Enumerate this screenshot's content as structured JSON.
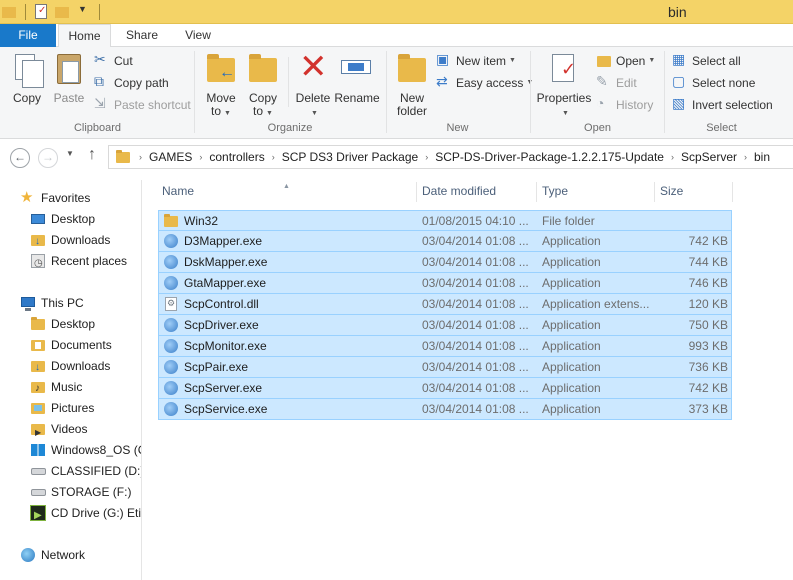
{
  "window": {
    "title": "bin"
  },
  "ribbon_tabs": [
    "File",
    "Home",
    "Share",
    "View"
  ],
  "clipboard": {
    "copy": "Copy",
    "paste": "Paste",
    "cut": "Cut",
    "copy_path": "Copy path",
    "paste_shortcut": "Paste shortcut",
    "label": "Clipboard"
  },
  "organize": {
    "move_to_1": "Move",
    "move_to_2": "to",
    "copy_to_1": "Copy",
    "copy_to_2": "to",
    "delete": "Delete",
    "rename": "Rename",
    "label": "Organize"
  },
  "new_group": {
    "new_folder_1": "New",
    "new_folder_2": "folder",
    "new_item": "New item",
    "easy_access": "Easy access",
    "label": "New"
  },
  "open_group": {
    "properties": "Properties",
    "open": "Open",
    "edit": "Edit",
    "history": "History",
    "label": "Open"
  },
  "select_group": {
    "select_all": "Select all",
    "select_none": "Select none",
    "invert": "Invert selection",
    "label": "Select"
  },
  "address": {
    "crumbs": [
      "GAMES",
      "controllers",
      "SCP DS3 Driver Package",
      "SCP-DS-Driver-Package-1.2.2.175-Update",
      "ScpServer",
      "bin"
    ]
  },
  "nav": {
    "favorites": "Favorites",
    "desktop": "Desktop",
    "downloads": "Downloads",
    "recent": "Recent places",
    "this_pc": "This PC",
    "pc_desktop": "Desktop",
    "documents": "Documents",
    "pc_downloads": "Downloads",
    "music": "Music",
    "pictures": "Pictures",
    "videos": "Videos",
    "win8": "Windows8_OS (C",
    "classified": "CLASSIFIED (D:)",
    "storage": "STORAGE (F:)",
    "cd": "CD Drive (G:) Etis",
    "network": "Network"
  },
  "columns": {
    "name": "Name",
    "date": "Date modified",
    "type": "Type",
    "size": "Size"
  },
  "files": [
    {
      "name": "Win32",
      "date": "01/08/2015 04:10 ...",
      "type": "File folder",
      "size": "",
      "icon": "folder-icon"
    },
    {
      "name": "D3Mapper.exe",
      "date": "03/04/2014 01:08 ...",
      "type": "Application",
      "size": "742 KB",
      "icon": "app-icon"
    },
    {
      "name": "DskMapper.exe",
      "date": "03/04/2014 01:08 ...",
      "type": "Application",
      "size": "744 KB",
      "icon": "app-icon"
    },
    {
      "name": "GtaMapper.exe",
      "date": "03/04/2014 01:08 ...",
      "type": "Application",
      "size": "746 KB",
      "icon": "app-icon"
    },
    {
      "name": "ScpControl.dll",
      "date": "03/04/2014 01:08 ...",
      "type": "Application extens...",
      "size": "120 KB",
      "icon": "dll-icon"
    },
    {
      "name": "ScpDriver.exe",
      "date": "03/04/2014 01:08 ...",
      "type": "Application",
      "size": "750 KB",
      "icon": "app-icon"
    },
    {
      "name": "ScpMonitor.exe",
      "date": "03/04/2014 01:08 ...",
      "type": "Application",
      "size": "993 KB",
      "icon": "app-icon"
    },
    {
      "name": "ScpPair.exe",
      "date": "03/04/2014 01:08 ...",
      "type": "Application",
      "size": "736 KB",
      "icon": "app-icon"
    },
    {
      "name": "ScpServer.exe",
      "date": "03/04/2014 01:08 ...",
      "type": "Application",
      "size": "742 KB",
      "icon": "app-icon"
    },
    {
      "name": "ScpService.exe",
      "date": "03/04/2014 01:08 ...",
      "type": "Application",
      "size": "373 KB",
      "icon": "app-icon"
    }
  ],
  "colors": {
    "accent": "#1979ca",
    "selection": "#cce8ff",
    "selection_border": "#99d1ff",
    "titlebar": "#f4d367"
  }
}
